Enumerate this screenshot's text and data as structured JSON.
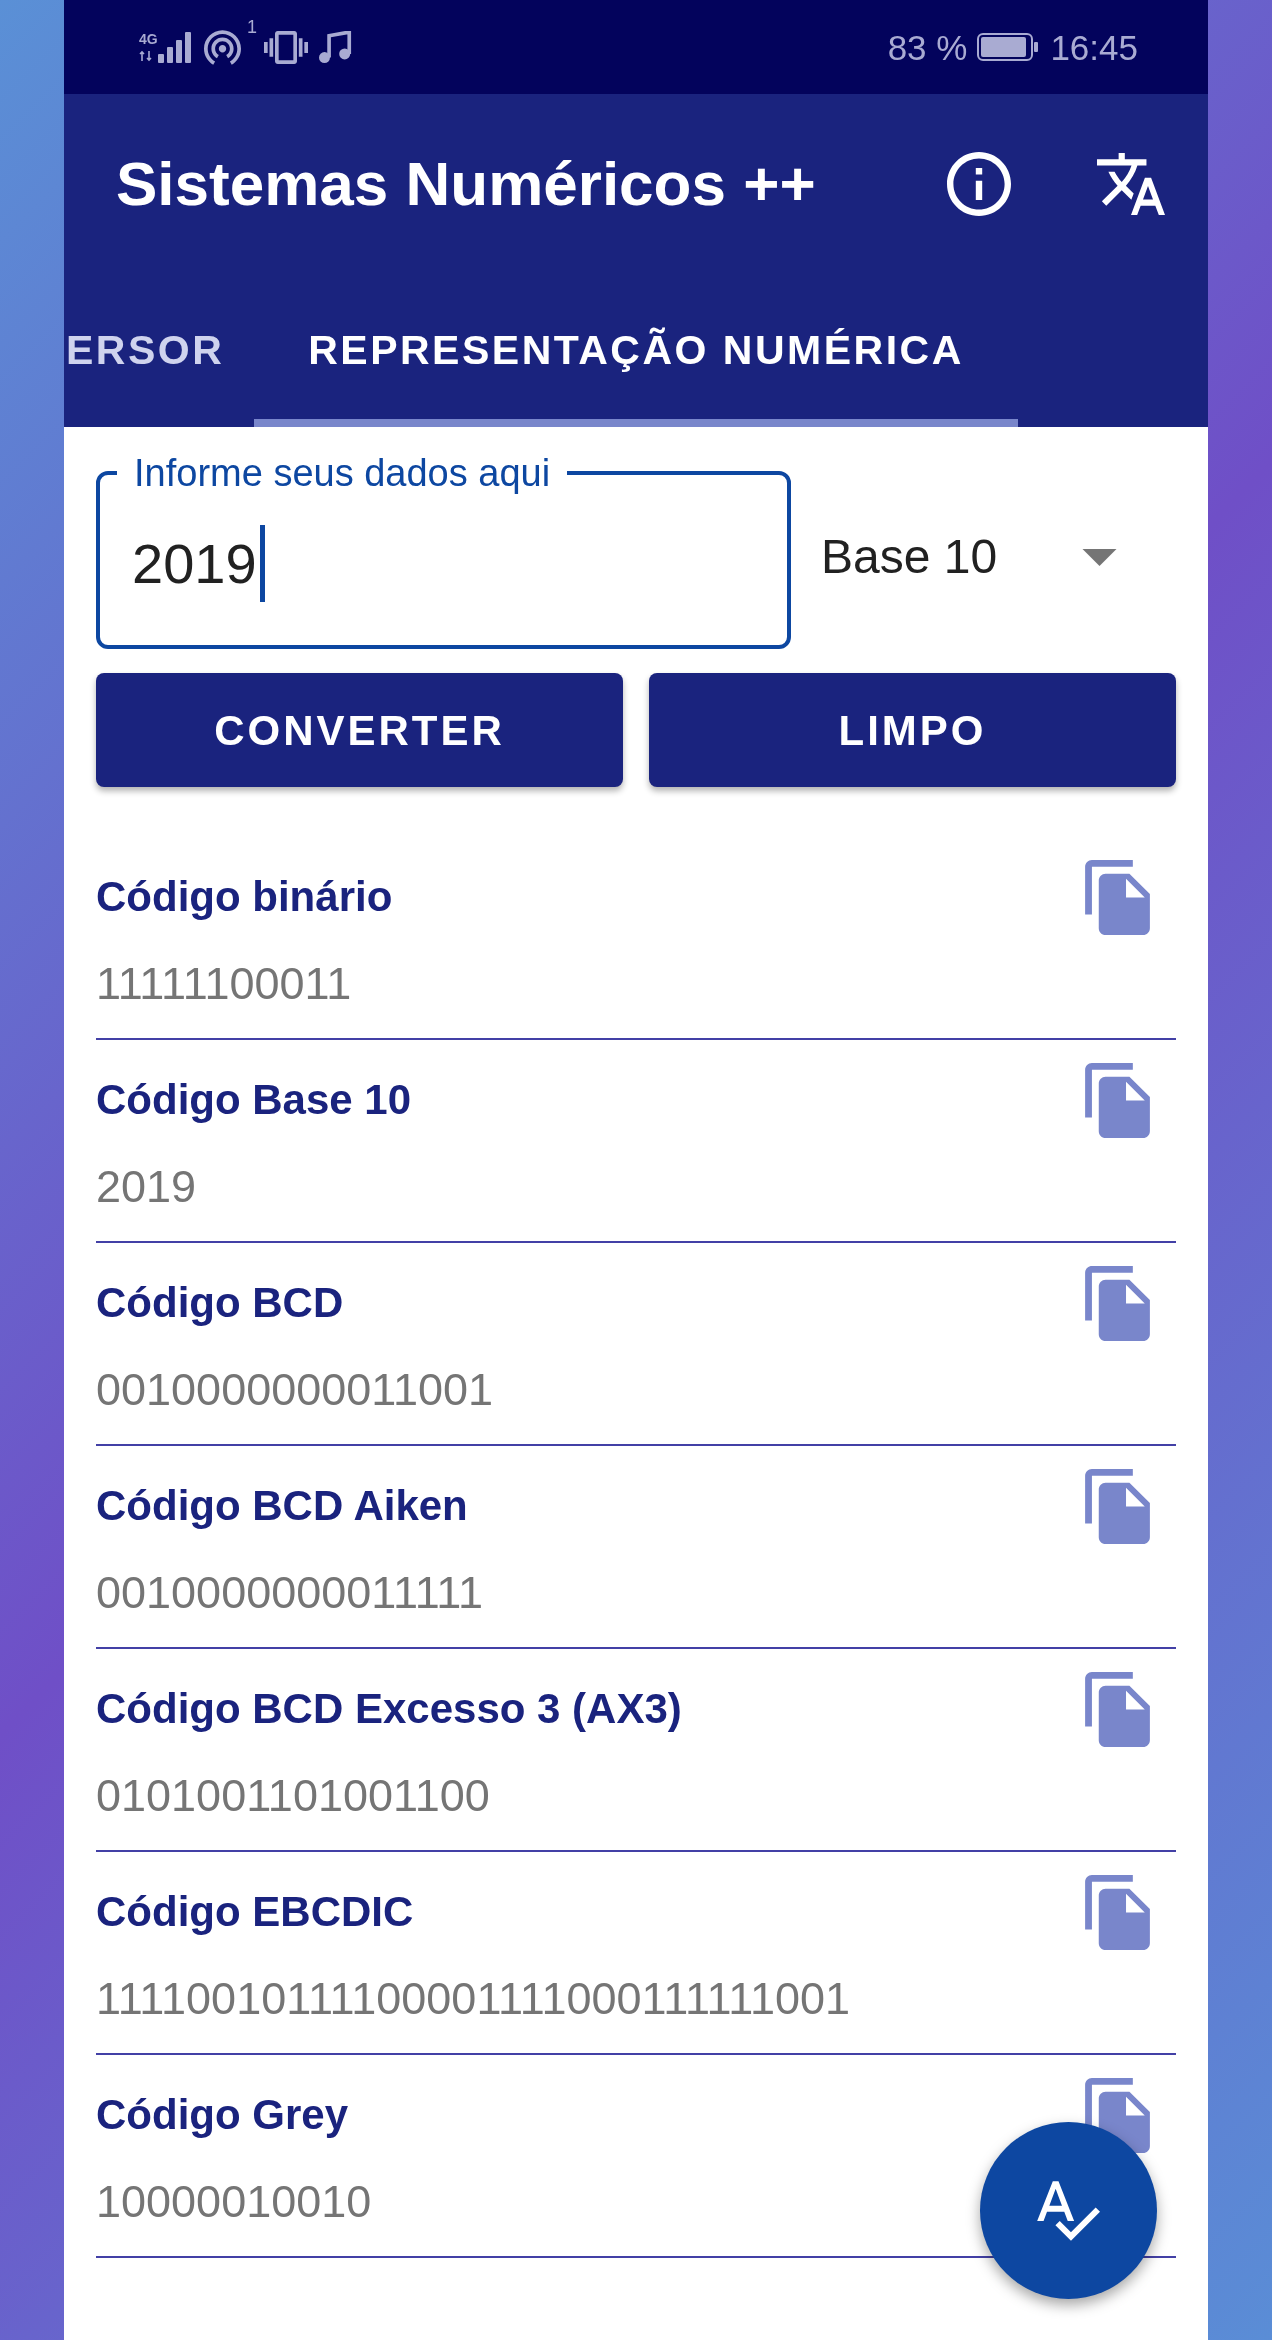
{
  "status_bar": {
    "network": "4G",
    "hotspot_count": "1",
    "battery": "83 %",
    "time": "16:45"
  },
  "app_bar": {
    "title": "Sistemas Numéricos ++"
  },
  "tabs": [
    {
      "label": "ERSOR",
      "selected": false
    },
    {
      "label": "REPRESENTAÇÃO NUMÉRICA",
      "selected": true
    }
  ],
  "input": {
    "label": "Informe seus dados aqui",
    "value": "2019",
    "focused": true
  },
  "base_select": {
    "value": "Base 10"
  },
  "buttons": [
    "CONVERTER",
    "LIMPO"
  ],
  "results": [
    {
      "title": "Código binário",
      "value": "11111100011"
    },
    {
      "title": "Código Base 10",
      "value": "2019"
    },
    {
      "title": "Código BCD",
      "value": "0010000000011001"
    },
    {
      "title": "Código BCD Aiken",
      "value": "0010000000011111"
    },
    {
      "title": "Código BCD Excesso 3 (AX3)",
      "value": "0101001101001100"
    },
    {
      "title": "Código EBCDIC",
      "value": "11110010111100001111000111111001"
    },
    {
      "title": "Código Grey",
      "value": "10000010010"
    }
  ]
}
